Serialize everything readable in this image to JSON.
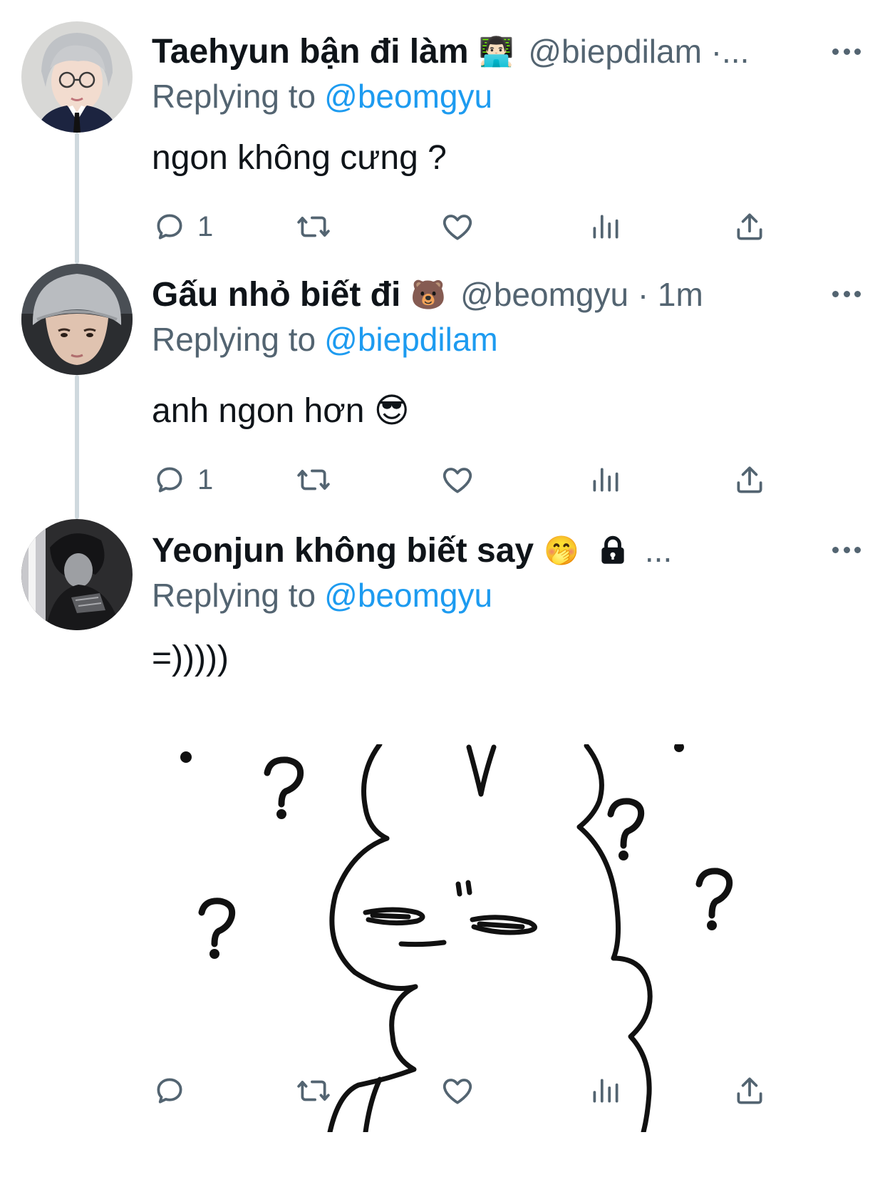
{
  "tweets": [
    {
      "display_name": "Taehyun bận đi làm",
      "emoji": "👨🏻‍💻",
      "handle": "@biepdilam ·...",
      "replying_label": "Replying to",
      "replying_to": "@beomgyu",
      "text": "ngon không cưng ?",
      "reply_count": "1"
    },
    {
      "display_name": "Gấu nhỏ biết đi",
      "emoji": "🐻",
      "handle": "@beomgyu · 1m",
      "replying_label": "Replying to",
      "replying_to": "@biepdilam",
      "text": "anh ngon hơn 😎",
      "reply_count": "1"
    },
    {
      "display_name": "Yeonjun không biết say",
      "emoji": "🤭",
      "lock_icon": "lock-icon",
      "handle": "...",
      "replying_label": "Replying to",
      "replying_to": "@beomgyu",
      "text": "=)))))",
      "reply_count": "",
      "media": "confused-cartoon-sticker"
    }
  ],
  "icons": {
    "reply": "reply-icon",
    "retweet": "retweet-icon",
    "like": "heart-icon",
    "views": "views-icon",
    "share": "share-icon",
    "more": "more-icon"
  },
  "colors": {
    "text": "#0f1419",
    "secondary": "#536471",
    "link": "#1d9bf0",
    "thread_line": "#cfd9de"
  }
}
